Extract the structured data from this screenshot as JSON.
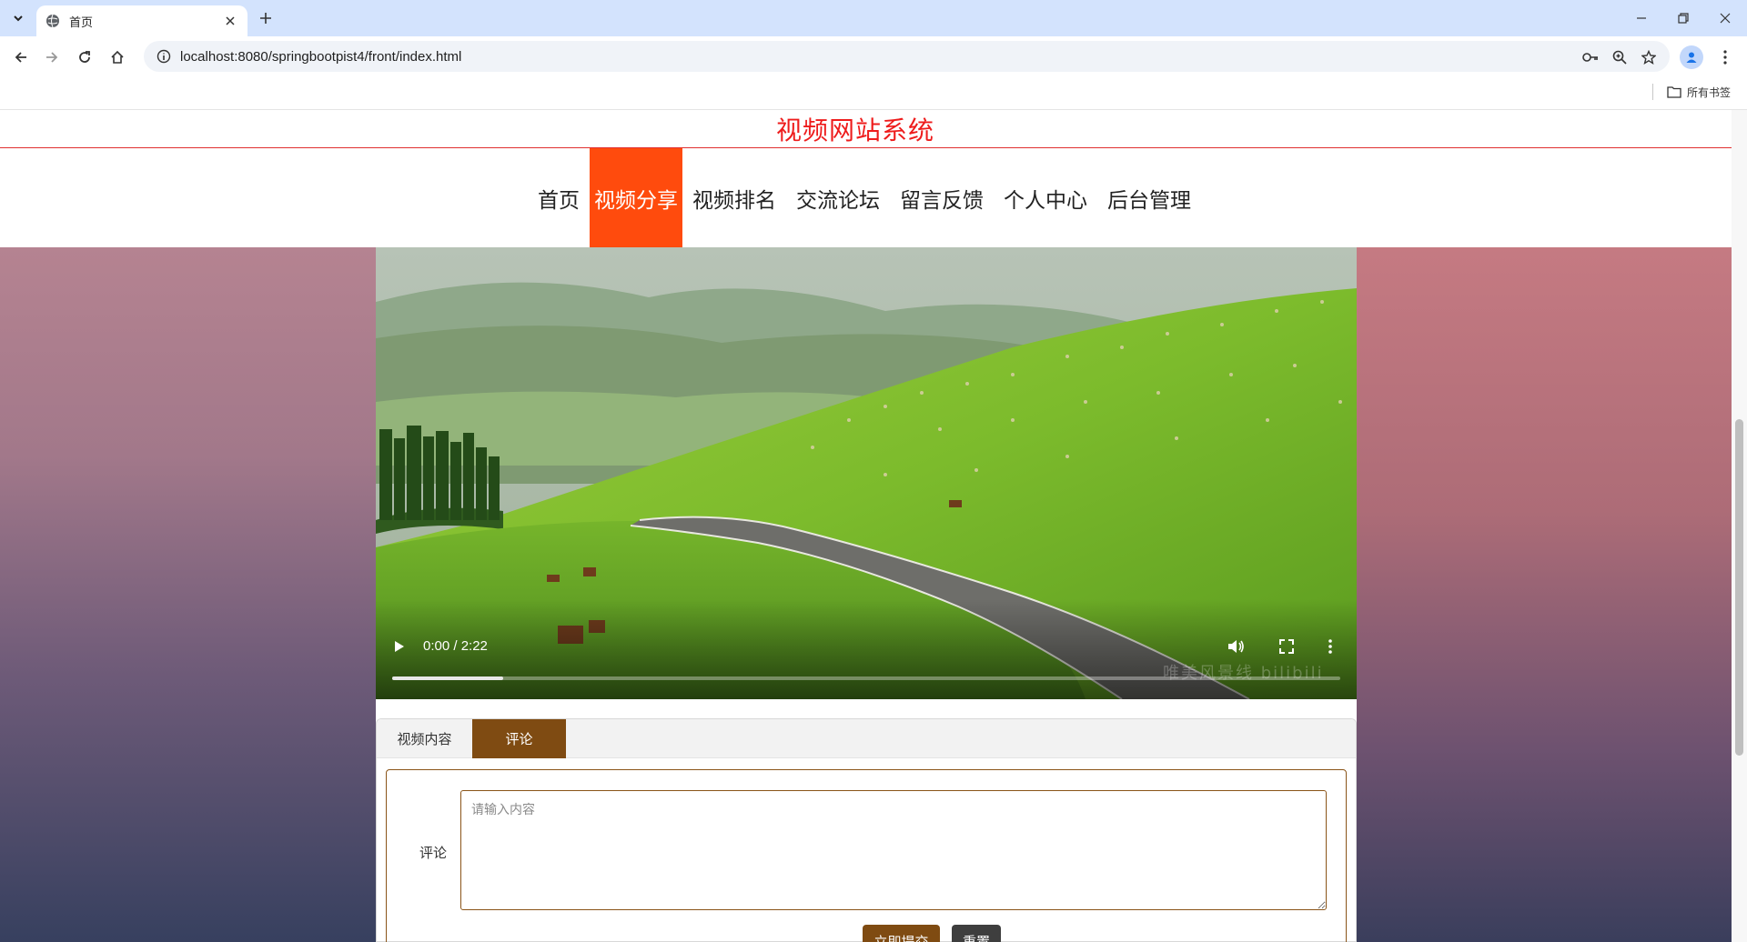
{
  "browser": {
    "tab_title": "首页",
    "url": "localhost:8080/springbootpist4/front/index.html",
    "bookmarks_label": "所有书签",
    "icons": [
      "tab-search-icon",
      "globe-icon",
      "close-icon",
      "plus-icon",
      "back-icon",
      "forward-icon",
      "reload-icon",
      "home-icon",
      "info-icon",
      "password-key-icon",
      "zoom-icon",
      "star-icon",
      "profile-icon",
      "more-vert-icon",
      "folder-icon",
      "minimize-icon",
      "restore-icon"
    ]
  },
  "site": {
    "title": "视频网站系统",
    "title_color": "#ee1c1c",
    "accent": "#ff4b0d"
  },
  "nav": {
    "items": [
      {
        "label": "首页",
        "active": false
      },
      {
        "label": "视频分享",
        "active": true
      },
      {
        "label": "视频排名",
        "active": false
      },
      {
        "label": "交流论坛",
        "active": false
      },
      {
        "label": "留言反馈",
        "active": false
      },
      {
        "label": "个人中心",
        "active": false
      },
      {
        "label": "后台管理",
        "active": false
      }
    ]
  },
  "video": {
    "time": "0:00 / 2:22",
    "progress_buffered": 0.117,
    "watermark": "唯美风景线 bilibili"
  },
  "tabs": {
    "items": [
      "视频内容",
      "评论"
    ],
    "active": "评论",
    "active_color": "#7f4b12"
  },
  "comment_form": {
    "label": "评论",
    "placeholder": "请输入内容",
    "value": "",
    "submit_label": "立即提交",
    "reset_label": "重置"
  }
}
